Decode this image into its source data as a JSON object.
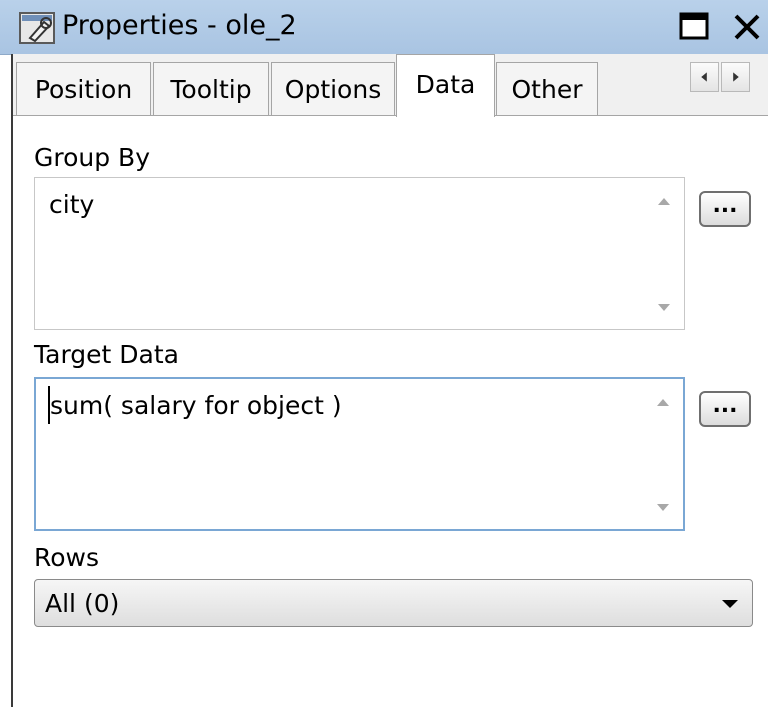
{
  "window": {
    "title": "Properties - ole_2",
    "icon": "properties-icon"
  },
  "tabs": [
    {
      "label": "Position",
      "active": false
    },
    {
      "label": "Tooltip",
      "active": false
    },
    {
      "label": "Options",
      "active": false
    },
    {
      "label": "Data",
      "active": true
    },
    {
      "label": "Other",
      "active": false
    }
  ],
  "group_by": {
    "label": "Group By",
    "value": "city",
    "button_label": "..."
  },
  "target_data": {
    "label": "Target Data",
    "value": "sum( salary for object )",
    "button_label": "..."
  },
  "rows": {
    "label": "Rows",
    "selected": "All (0)"
  }
}
